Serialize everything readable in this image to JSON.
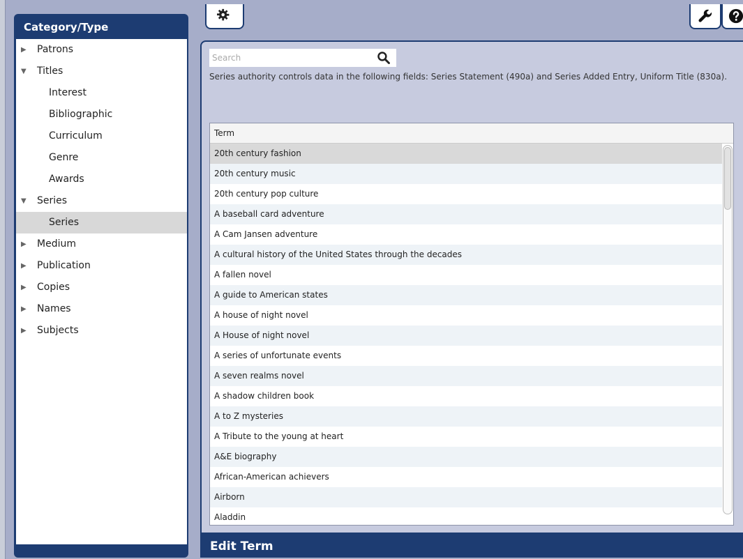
{
  "sidebar": {
    "title": "Category/Type",
    "items": [
      {
        "label": "Patrons",
        "arrow": "▶",
        "level": 0
      },
      {
        "label": "Titles",
        "arrow": "▼",
        "level": 0
      },
      {
        "label": "Interest",
        "arrow": "",
        "level": 1
      },
      {
        "label": "Bibliographic",
        "arrow": "",
        "level": 1
      },
      {
        "label": "Curriculum",
        "arrow": "",
        "level": 1
      },
      {
        "label": "Genre",
        "arrow": "",
        "level": 1
      },
      {
        "label": "Awards",
        "arrow": "",
        "level": 1
      },
      {
        "label": "Series",
        "arrow": "▼",
        "level": 0
      },
      {
        "label": "Series",
        "arrow": "",
        "level": 1,
        "selected": true
      },
      {
        "label": "Medium",
        "arrow": "▶",
        "level": 0
      },
      {
        "label": "Publication",
        "arrow": "▶",
        "level": 0
      },
      {
        "label": "Copies",
        "arrow": "▶",
        "level": 0
      },
      {
        "label": "Names",
        "arrow": "▶",
        "level": 0
      },
      {
        "label": "Subjects",
        "arrow": "▶",
        "level": 0
      }
    ]
  },
  "toolbar": {
    "gear_icon": "gear-icon",
    "wrench_icon": "wrench-icon",
    "help_icon": "help-icon"
  },
  "search": {
    "placeholder": "Search",
    "value": ""
  },
  "description": "Series authority controls data in the following fields: Series Statement (490a) and Series Added Entry, Uniform Title (830a).",
  "table": {
    "header": "Term",
    "rows": [
      "20th century fashion",
      "20th century music",
      "20th century pop culture",
      "A baseball card adventure",
      "A Cam Jansen adventure",
      "A cultural history of the United States through the decades",
      "A fallen novel",
      "A guide to American states",
      "A house of night novel",
      "A House of night novel",
      "A series of unfortunate events",
      "A seven realms novel",
      "A shadow children book",
      "A to Z mysteries",
      "A Tribute to the young at heart",
      "A&E biography",
      "African-American achievers",
      "Airborn",
      "Aladdin"
    ],
    "selected_index": 0
  },
  "edit_bar": {
    "title": "Edit Term"
  },
  "colors": {
    "navy": "#1d3c72",
    "panel": "#c7cbdf",
    "background": "#a6adc9"
  }
}
